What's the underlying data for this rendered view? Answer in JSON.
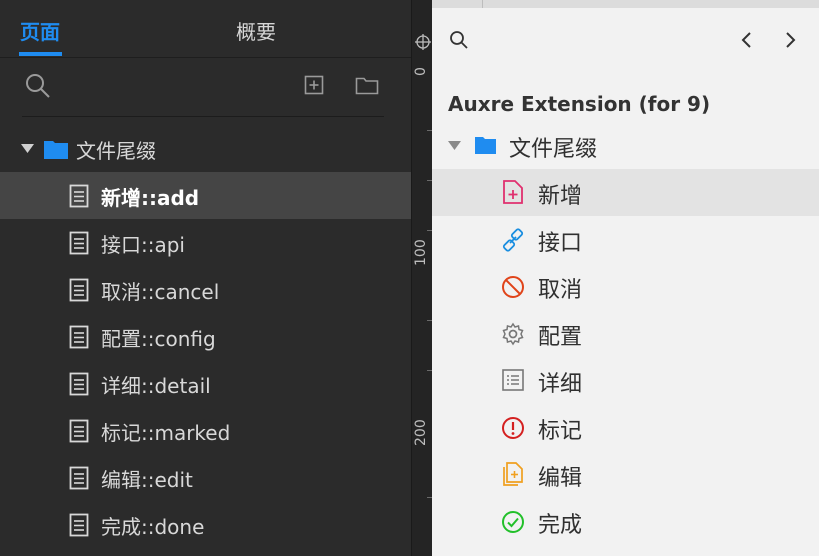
{
  "left_panel": {
    "tabs": {
      "pages": "页面",
      "overview": "概要"
    },
    "folder": {
      "label": "文件尾缀"
    },
    "pages": [
      {
        "label": "新增::add"
      },
      {
        "label": "接口::api"
      },
      {
        "label": "取消::cancel"
      },
      {
        "label": "配置::config"
      },
      {
        "label": "详细::detail"
      },
      {
        "label": "标记::marked"
      },
      {
        "label": "编辑::edit"
      },
      {
        "label": "完成::done"
      }
    ]
  },
  "ruler": {
    "labels": [
      "0",
      "100",
      "200"
    ]
  },
  "right_panel": {
    "title": "Auxre Extension (for 9)",
    "folder": {
      "label": "文件尾缀"
    },
    "items": [
      {
        "label": "新增",
        "icon": "file-plus-icon",
        "color": "#e0306f"
      },
      {
        "label": "接口",
        "icon": "link-icon",
        "color": "#1a8ee0"
      },
      {
        "label": "取消",
        "icon": "cancel-circle-icon",
        "color": "#e0441a"
      },
      {
        "label": "配置",
        "icon": "gear-icon",
        "color": "#777777"
      },
      {
        "label": "详细",
        "icon": "list-doc-icon",
        "color": "#777777"
      },
      {
        "label": "标记",
        "icon": "exclamation-circle-icon",
        "color": "#d42020"
      },
      {
        "label": "编辑",
        "icon": "file-edit-icon",
        "color": "#f0a020"
      },
      {
        "label": "完成",
        "icon": "check-circle-icon",
        "color": "#22c02a"
      }
    ]
  },
  "colors": {
    "accent": "#1f8cf0",
    "folder": "#1f8cf0",
    "dark_bg": "#2b2b2b",
    "light_bg": "#f2f2f2"
  }
}
